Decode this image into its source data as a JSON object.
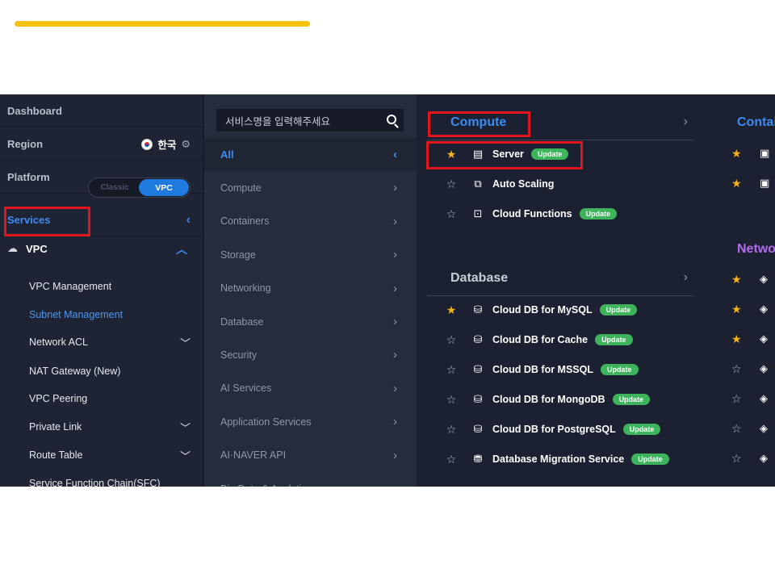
{
  "sidebar": {
    "dashboard": "Dashboard",
    "region_label": "Region",
    "region_value": "한국",
    "platform_label": "Platform",
    "platform_options": {
      "classic": "Classic",
      "vpc": "VPC"
    },
    "services_label": "Services",
    "vpc_section": "VPC",
    "vpc_items": [
      {
        "label": "VPC Management"
      },
      {
        "label": "Subnet Management",
        "active": true
      },
      {
        "label": "Network ACL",
        "expandable": true
      },
      {
        "label": "NAT Gateway (New)"
      },
      {
        "label": "VPC Peering"
      },
      {
        "label": "Private Link",
        "expandable": true
      },
      {
        "label": "Route Table",
        "expandable": true
      },
      {
        "label": "Service Function Chain(SFC)"
      }
    ]
  },
  "search": {
    "placeholder": "서비스명을 입력해주세요"
  },
  "categories": [
    "All",
    "Compute",
    "Containers",
    "Storage",
    "Networking",
    "Database",
    "Security",
    "AI Services",
    "Application Services",
    "AI·NAVER API",
    "Big Data & Analytics"
  ],
  "compute": {
    "title": "Compute",
    "items": [
      {
        "name": "Server",
        "starred": true,
        "badge": "Update",
        "icon": "server-icon"
      },
      {
        "name": "Auto Scaling",
        "starred": false,
        "badge": "",
        "icon": "auto-scaling-icon"
      },
      {
        "name": "Cloud Functions",
        "starred": false,
        "badge": "Update",
        "icon": "cloud-functions-icon"
      }
    ]
  },
  "database": {
    "title": "Database",
    "items": [
      {
        "name": "Cloud DB for MySQL",
        "starred": true,
        "badge": "Update"
      },
      {
        "name": "Cloud DB for Cache",
        "starred": false,
        "badge": "Update"
      },
      {
        "name": "Cloud DB for MSSQL",
        "starred": false,
        "badge": "Update"
      },
      {
        "name": "Cloud DB for MongoDB",
        "starred": false,
        "badge": "Update"
      },
      {
        "name": "Cloud DB for PostgreSQL",
        "starred": false,
        "badge": "Update"
      },
      {
        "name": "Database Migration Service",
        "starred": false,
        "badge": "Update"
      }
    ]
  },
  "col4": {
    "containers_title": "Contai",
    "networking_title": "Netwo",
    "containers_stars": [
      true,
      true
    ],
    "networking_stars": [
      true,
      true,
      true,
      false,
      false,
      false,
      false
    ]
  },
  "colors": {
    "accent_bar": "#f5c211",
    "highlight": "#e0161f",
    "link_blue": "#3d8bf0",
    "badge_green": "#3db35b",
    "star_gold": "#f4b41a",
    "networking_title": "#b26cf0"
  }
}
